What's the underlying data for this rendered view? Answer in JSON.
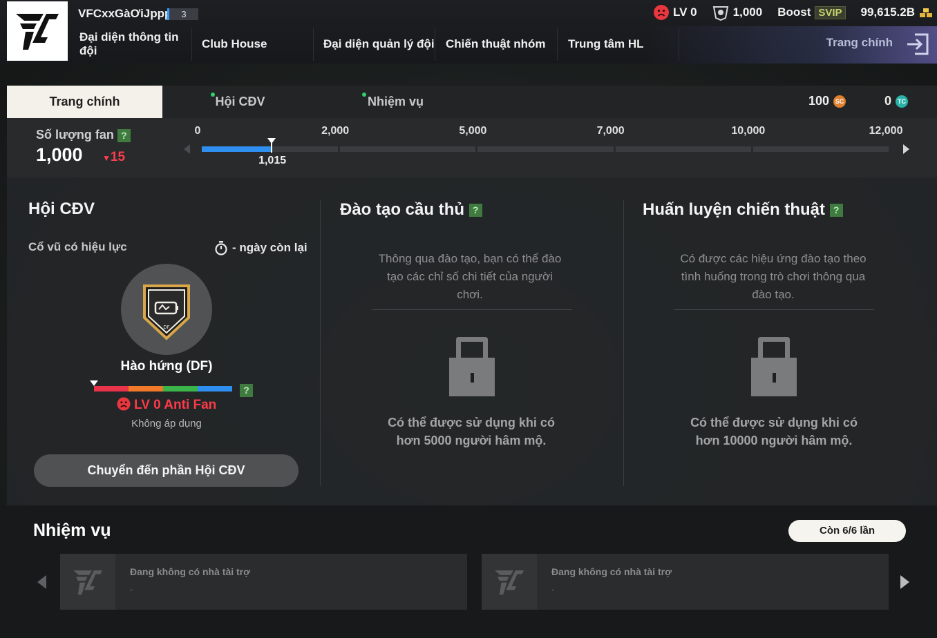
{
  "header": {
    "team_name": "VFCxxGàƠiJpppp",
    "team_badge": "3",
    "nav": [
      {
        "label": "Đại diện thông tin đội"
      },
      {
        "label": "Club House"
      },
      {
        "label": "Đại diện quản lý đội"
      },
      {
        "label": "Chiến thuật nhóm"
      },
      {
        "label": "Trung tâm HL"
      }
    ],
    "home_link": "Trang chính",
    "stats": {
      "level": "LV 0",
      "fans": "1,000",
      "boost_label": "Boost",
      "svip": "SVIP",
      "balance": "99,615.2B"
    }
  },
  "tabs": [
    {
      "label": "Trang chính",
      "active": true
    },
    {
      "label": "Hội CĐV",
      "dot": true
    },
    {
      "label": "Nhiệm vụ",
      "dot": true
    }
  ],
  "currencies": {
    "sc_amount": "100",
    "sc_icon": "SC",
    "tc_amount": "0",
    "tc_icon": "TC"
  },
  "fan_progress": {
    "label": "Số lượng fan",
    "help": "?",
    "count": "1,000",
    "delta": "15",
    "ticks": [
      "0",
      "2,000",
      "5,000",
      "7,000",
      "10,000",
      "12,000"
    ],
    "marker_label": "1,015",
    "current_value": 1015
  },
  "club": {
    "title": "Hội CĐV",
    "cheer_label": "Cổ vũ có hiệu lực",
    "days_left": "- ngày còn lại",
    "emblem_name": "Hào hứng (DF)",
    "emblem_tag": "DF",
    "help": "?",
    "level_status": "LV 0 Anti Fan",
    "not_apply": "Không áp dụng",
    "goto_button": "Chuyển đến phần Hội CĐV"
  },
  "training": {
    "title": "Đào tạo cầu thủ",
    "help": "?",
    "description": "Thông qua đào tạo, bạn có thể đào tạo các chỉ số chi tiết của người chơi.",
    "unlock_text": "Có thể được sử dụng khi có hơn 5000 người hâm mộ."
  },
  "tactics": {
    "title": "Huấn luyện chiến thuật",
    "help": "?",
    "description": "Có được các hiệu ứng đào tạo theo tình huống trong trò chơi thông qua đào tạo.",
    "unlock_text": "Có thể được sử dụng khi có hơn 10000 người hâm mộ."
  },
  "missions": {
    "title": "Nhiệm vụ",
    "remaining": "Còn 6/6 lần",
    "cards": [
      {
        "text": "Đang không có nhà tài trợ",
        "sub": "-"
      },
      {
        "text": "Đang không có nhà tài trợ",
        "sub": "-"
      }
    ]
  },
  "colors": {
    "accent_blue": "#2f8ff0",
    "alert_red": "#ff3a48",
    "level_segments": [
      "#e8334a",
      "#f0792a",
      "#3bb54a",
      "#2f8ff0"
    ]
  }
}
